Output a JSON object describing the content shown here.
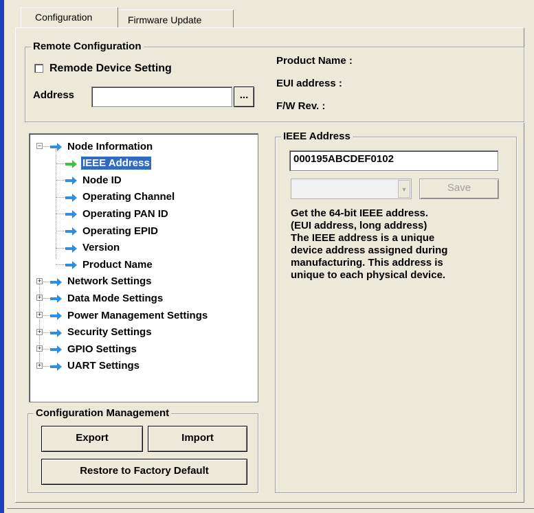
{
  "tabs": {
    "configuration": "Configuration",
    "firmware_update": "Firmware Update"
  },
  "remote_config": {
    "legend": "Remote Configuration",
    "device_setting_label": "Remode Device Setting",
    "device_setting_checked": false,
    "address_label": "Address",
    "address_value": "",
    "browse_button": "...",
    "product_name_label": "Product Name :",
    "eui_label": "EUI address :",
    "fw_rev_label": "F/W Rev. :"
  },
  "tree": {
    "items": [
      {
        "label": "Node Information",
        "expander": "−",
        "icon": "blue-arrow-icon"
      },
      {
        "label": "IEEE Address",
        "icon": "green-arrow-icon",
        "selected": true
      },
      {
        "label": "Node ID",
        "icon": "blue-arrow-icon"
      },
      {
        "label": "Operating Channel",
        "icon": "blue-arrow-icon"
      },
      {
        "label": "Operating PAN ID",
        "icon": "blue-arrow-icon"
      },
      {
        "label": "Operating EPID",
        "icon": "blue-arrow-icon"
      },
      {
        "label": "Version",
        "icon": "blue-arrow-icon"
      },
      {
        "label": "Product Name",
        "icon": "blue-arrow-icon"
      },
      {
        "label": "Network Settings",
        "expander": "+",
        "icon": "blue-arrow-icon"
      },
      {
        "label": "Data Mode Settings",
        "expander": "+",
        "icon": "blue-arrow-icon"
      },
      {
        "label": "Power Management Settings",
        "expander": "+",
        "icon": "blue-arrow-icon"
      },
      {
        "label": "Security Settings",
        "expander": "+",
        "icon": "blue-arrow-icon"
      },
      {
        "label": "GPIO Settings",
        "expander": "+",
        "icon": "blue-arrow-icon"
      },
      {
        "label": "UART Settings",
        "expander": "+",
        "icon": "blue-arrow-icon"
      }
    ]
  },
  "config_mgmt": {
    "legend": "Configuration Management",
    "export_button": "Export",
    "import_button": "Import",
    "restore_button": "Restore to Factory Default"
  },
  "ieee": {
    "legend": "IEEE Address",
    "value": "000195ABCDEF0102",
    "combo_value": "",
    "save_button": "Save",
    "description": [
      "Get the 64-bit IEEE address.",
      "(EUI address, long address)",
      "The IEEE address is a unique",
      "device address assigned during",
      "manufacturing. This address is",
      "unique to each physical device."
    ]
  },
  "colors": {
    "accent_blue": "#316ac5",
    "arrow_blue": "#2b8fe6",
    "arrow_green": "#3cc43c",
    "window_bg": "#ece9d8"
  }
}
